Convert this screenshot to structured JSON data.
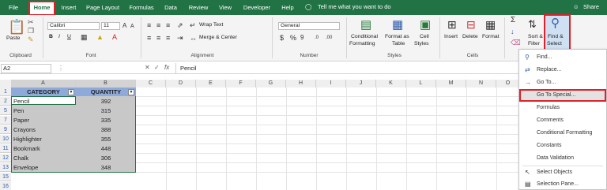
{
  "tabs": [
    "File",
    "Home",
    "Insert",
    "Page Layout",
    "Formulas",
    "Data",
    "Review",
    "View",
    "Developer",
    "Help"
  ],
  "tell_me": "Tell me what you want to do",
  "share": "Share",
  "ribbon": {
    "paste": "Paste",
    "font_name": "Calibri",
    "font_size": "11",
    "bold": "B",
    "italic": "I",
    "underline": "U",
    "wrap_text": "Wrap Text",
    "merge_center": "Merge & Center",
    "number_format": "General",
    "cond_format_1": "Conditional",
    "cond_format_2": "Formatting",
    "format_table_1": "Format as",
    "format_table_2": "Table",
    "cell_styles_1": "Cell",
    "cell_styles_2": "Styles",
    "insert": "Insert",
    "delete": "Delete",
    "format": "Format",
    "sort_filter_1": "Sort &",
    "sort_filter_2": "Filter",
    "find_select_1": "Find &",
    "find_select_2": "Select",
    "groups": {
      "clipboard": "Clipboard",
      "font": "Font",
      "alignment": "Alignment",
      "number": "Number",
      "styles": "Styles",
      "cells": "Cells"
    }
  },
  "formula_bar": {
    "name_box": "A2",
    "fx": "fx",
    "value": "Pencil"
  },
  "columns": [
    "A",
    "B",
    "C",
    "D",
    "E",
    "F",
    "G",
    "H",
    "I",
    "J",
    "K",
    "L",
    "M",
    "N",
    "O",
    "P"
  ],
  "rows": [
    "1",
    "2",
    "5",
    "7",
    "9",
    "10",
    "11",
    "12",
    "13",
    "15",
    "16"
  ],
  "table": {
    "headers": [
      "CATEGORY",
      "QUANTITY"
    ],
    "data": [
      [
        "Pencil",
        "392"
      ],
      [
        "Pen",
        "315"
      ],
      [
        "Paper",
        "335"
      ],
      [
        "Crayons",
        "388"
      ],
      [
        "Highlighter",
        "355"
      ],
      [
        "Bookmark",
        "448"
      ],
      [
        "Chalk",
        "306"
      ],
      [
        "Envelope",
        "348"
      ]
    ]
  },
  "menu": {
    "items": [
      "Find...",
      "Replace...",
      "Go To...",
      "Go To Special...",
      "Formulas",
      "Comments",
      "Conditional Formatting",
      "Constants",
      "Data Validation",
      "Select Objects",
      "Selection Pane..."
    ]
  },
  "colors": {
    "excel_green": "#217346",
    "highlight_red": "#e0202a",
    "selection": "#c8c8c8"
  }
}
